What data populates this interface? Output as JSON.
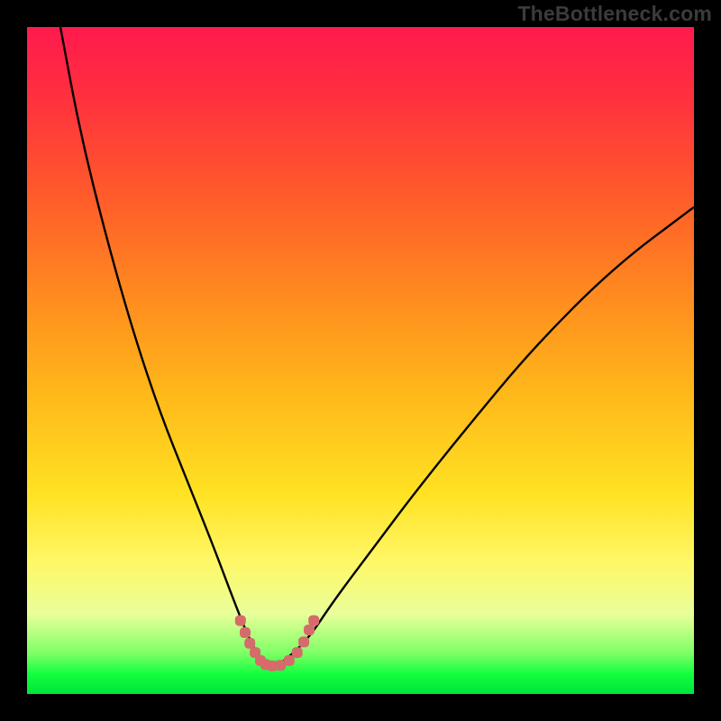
{
  "watermark": "TheBottleneck.com",
  "colors": {
    "page_bg": "#000000",
    "gradient_top": "#ff1a4d",
    "gradient_mid1": "#ff8a1f",
    "gradient_mid2": "#ffe223",
    "gradient_bottom": "#00e53a",
    "curve": "#000000",
    "marker_stroke": "#d66b6b",
    "marker_fill": "#d66b6b"
  },
  "chart_data": {
    "type": "line",
    "title": "",
    "xlabel": "",
    "ylabel": "",
    "xlim": [
      0,
      100
    ],
    "ylim": [
      0,
      100
    ],
    "grid": false,
    "legend": false,
    "series": [
      {
        "name": "bottleneck-curve",
        "x": [
          5,
          8,
          12,
          16,
          20,
          24,
          28,
          31,
          33,
          34.5,
          36,
          37,
          38,
          42,
          46,
          52,
          58,
          66,
          76,
          88,
          100
        ],
        "y": [
          100,
          84,
          68,
          54,
          42,
          32,
          22,
          14,
          9,
          6,
          4.5,
          4.2,
          4.5,
          8,
          14,
          22,
          30,
          40,
          52,
          64,
          73
        ]
      }
    ],
    "markers": [
      {
        "x": 32.0,
        "y": 11.0
      },
      {
        "x": 32.7,
        "y": 9.2
      },
      {
        "x": 33.4,
        "y": 7.6
      },
      {
        "x": 34.2,
        "y": 6.2
      },
      {
        "x": 35.0,
        "y": 5.0
      },
      {
        "x": 35.8,
        "y": 4.4
      },
      {
        "x": 36.8,
        "y": 4.2
      },
      {
        "x": 38.0,
        "y": 4.3
      },
      {
        "x": 39.3,
        "y": 5.0
      },
      {
        "x": 40.5,
        "y": 6.2
      },
      {
        "x": 41.5,
        "y": 7.8
      },
      {
        "x": 42.3,
        "y": 9.6
      },
      {
        "x": 43.0,
        "y": 11.0
      }
    ]
  }
}
